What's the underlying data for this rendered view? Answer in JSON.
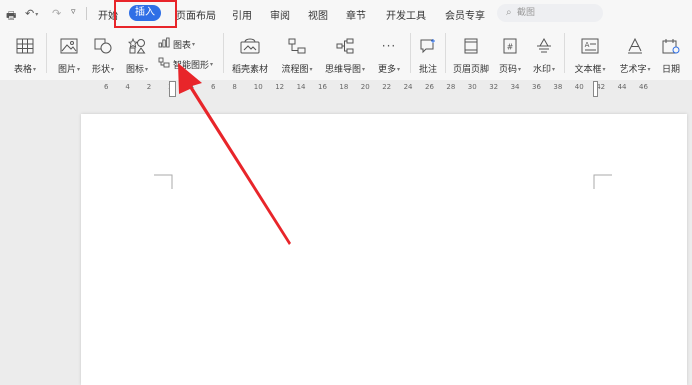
{
  "quick_access": {
    "undo_icon": "undo-icon",
    "redo_icon": "redo-icon"
  },
  "menu": {
    "tabs": [
      "开始",
      "插入",
      "页面布局",
      "引用",
      "审阅",
      "视图",
      "章节",
      "开发工具",
      "会员专享"
    ],
    "active_tab": "插入",
    "search_placeholder": "截图"
  },
  "ribbon": {
    "table": "表格",
    "picture": "图片",
    "shape": "形状",
    "icon": "图标",
    "chart": "图表",
    "smart_art": "智能图形",
    "stock_material": "稻壳素材",
    "flowchart": "流程图",
    "mindmap": "思维导图",
    "more": "更多",
    "comment": "批注",
    "header_footer": "页眉页脚",
    "page_number": "页码",
    "watermark": "水印",
    "textbox": "文本框",
    "wordart": "艺术字",
    "date": "日期"
  },
  "ruler": {
    "ticks": [
      "6",
      "4",
      "2",
      "2",
      "4",
      "6",
      "8",
      "10",
      "12",
      "14",
      "16",
      "18",
      "20",
      "22",
      "24",
      "26",
      "28",
      "30",
      "32",
      "34",
      "36",
      "38",
      "40",
      "42",
      "44",
      "46"
    ]
  },
  "colors": {
    "accent": "#2f6fe6",
    "annotation": "#e8252a",
    "page": "#ffffff",
    "workspace": "#ececec"
  }
}
